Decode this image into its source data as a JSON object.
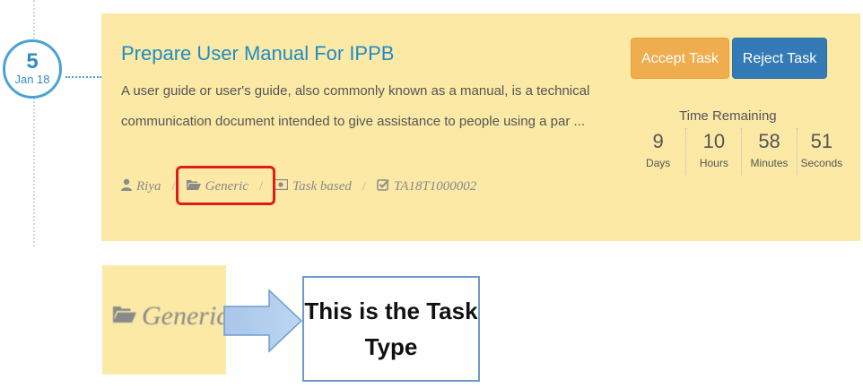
{
  "timeline": {
    "day": "5",
    "month": "Jan 18"
  },
  "task": {
    "title": "Prepare User Manual For IPPB",
    "description": "A user guide or user's guide, also commonly known as a manual, is a technical communication document intended to give assistance to people using a par ...",
    "accept_label": "Accept Task",
    "reject_label": "Reject Task",
    "time_remaining_title": "Time Remaining",
    "timer": [
      {
        "value": "9",
        "label": "Days"
      },
      {
        "value": "10",
        "label": "Hours"
      },
      {
        "value": "58",
        "label": "Minutes"
      },
      {
        "value": "51",
        "label": "Seconds"
      }
    ],
    "meta": {
      "user": "Riya",
      "type": "Generic",
      "category": "Task based",
      "id": "TA18T1000002",
      "user_icon": "user-icon",
      "type_icon": "folder-open-icon",
      "category_icon": "money-icon",
      "id_icon": "check-square-icon"
    }
  },
  "annotation": {
    "zoom_label": "Generic",
    "callout": "This is the Task Type"
  },
  "colors": {
    "card_bg": "#fbe9a5",
    "accent_blue": "#1f8bc7",
    "accept": "#f0ad4e",
    "reject": "#337ab7",
    "highlight": "#e11b1b"
  }
}
